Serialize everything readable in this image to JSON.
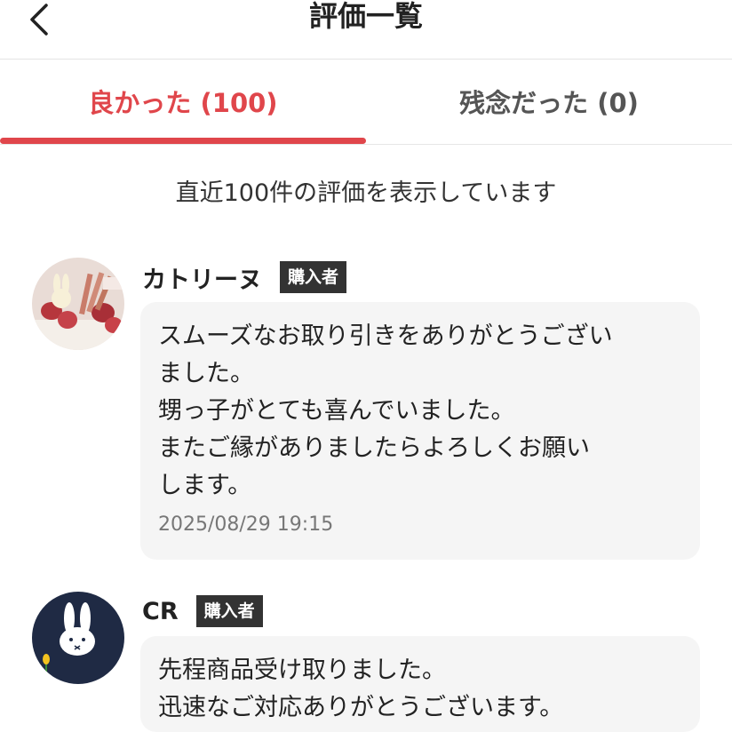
{
  "header": {
    "title": "評価一覧",
    "back_icon": "chevron-left-icon"
  },
  "tabs": [
    {
      "label": "良かった (100)",
      "active": true
    },
    {
      "label": "残念だった (0)",
      "active": false
    }
  ],
  "summary_text": "直近100件の評価を表示しています",
  "accent_color": "#e0464b",
  "reviews": [
    {
      "name": "カトリーヌ",
      "badge": "購入者",
      "avatar": "cake-photo-avatar",
      "comment_lines": [
        "スムーズなお取り引きをありがとうござい",
        "ました。",
        "甥っ子がとても喜んでいました。",
        "またご縁がありましたらよろしくお願い",
        "します。"
      ],
      "timestamp": "2025/08/29 19:15"
    },
    {
      "name": "CR",
      "badge": "購入者",
      "avatar": "rabbit-illustration-avatar",
      "comment_lines": [
        "先程商品受け取りました。",
        "迅速なご対応ありがとうございます。"
      ]
    }
  ]
}
